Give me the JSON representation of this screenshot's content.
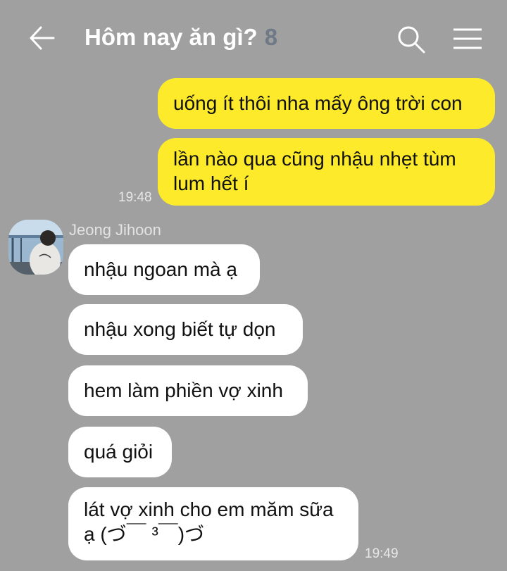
{
  "header": {
    "title": "Hôm nay ăn gì?",
    "member_count": "8",
    "icons": [
      "back-arrow-icon",
      "search-icon",
      "hamburger-menu-icon"
    ]
  },
  "messages": {
    "me": [
      {
        "text": "uống ít thôi nha mấy ông trời con"
      },
      {
        "text": "lần nào qua cũng nhậu nhẹt tùm lum hết í"
      }
    ],
    "me_time": "19:48",
    "sender_name": "Jeong Jihoon",
    "them": [
      {
        "text": "nhậu ngoan mà ạ"
      },
      {
        "text": "nhậu xong biết tự dọn"
      },
      {
        "text": "hem làm phiền vợ xinh"
      },
      {
        "text": "quá giỏi"
      },
      {
        "text": "lát vợ xinh cho em măm sữa ạ (づ￣ ³￣)づ"
      }
    ],
    "them_time": "19:49"
  },
  "colors": {
    "background": "#a0a0a0",
    "my_bubble": "#fcea2b",
    "their_bubble": "#ffffff",
    "member_count": "#6f7a86"
  }
}
